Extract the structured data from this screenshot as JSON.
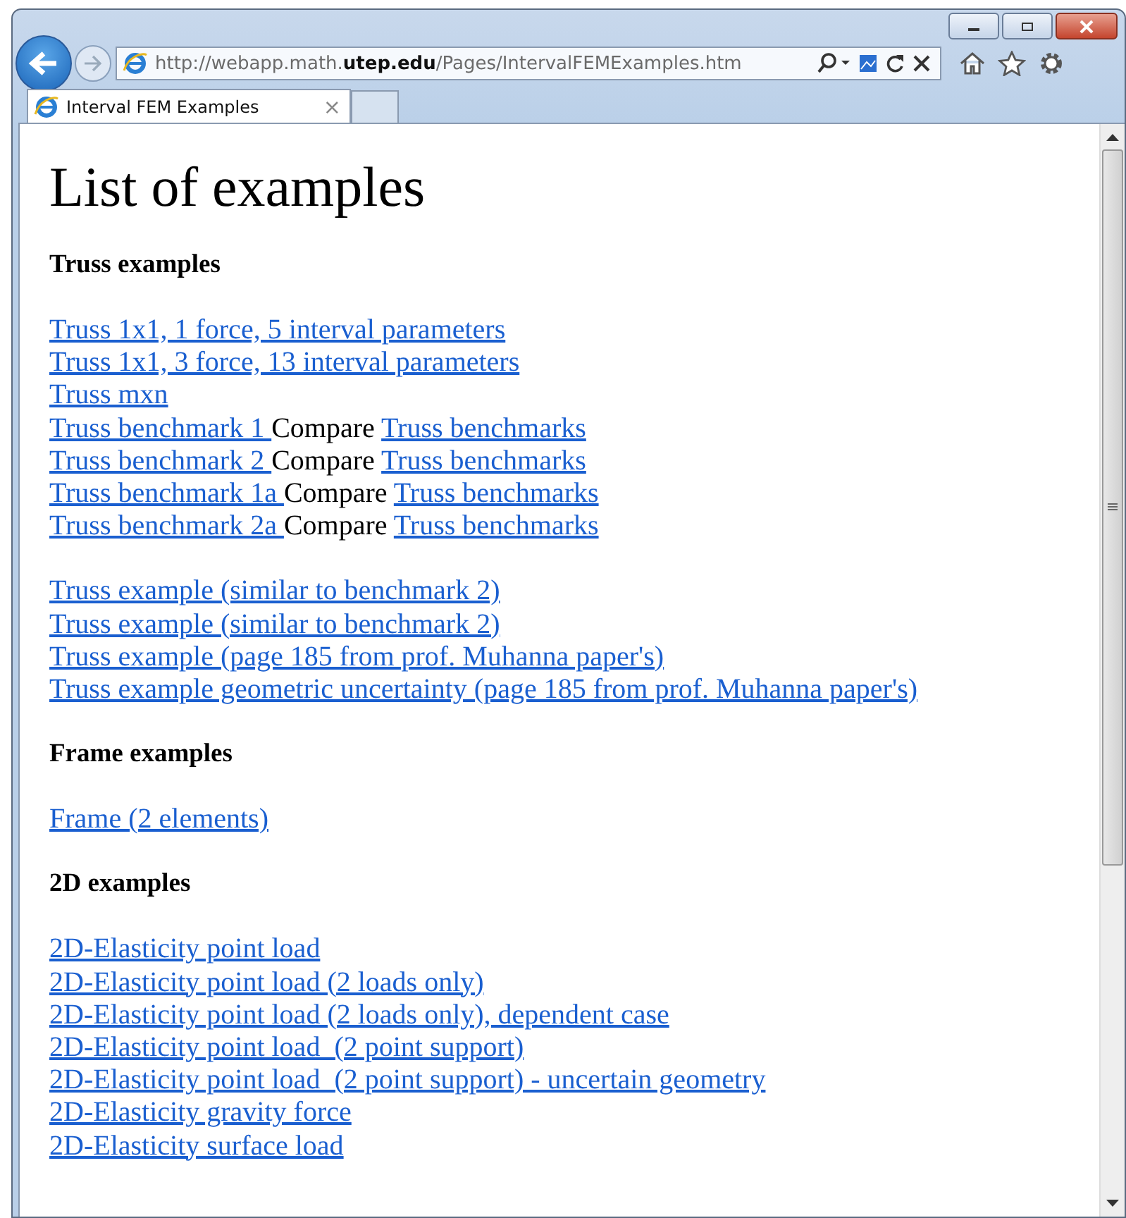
{
  "browser": {
    "url": "http://webapp.math.**utep.edu**/Pages/IntervalFEMExamples.htm",
    "tabs": [
      {
        "label": "Interval FEM Examples",
        "close": "×",
        "selected": true
      }
    ]
  },
  "page": {
    "title": "List of examples",
    "sections": [
      {
        "heading": "Truss examples",
        "groups": [
          [
            [
              {
                "kind": "link",
                "text": "Truss 1x1, 1 force, 5 interval parameters"
              }
            ],
            [
              {
                "kind": "link",
                "text": "Truss 1x1, 3 force, 13 interval parameters"
              }
            ],
            [
              {
                "kind": "link",
                "text": "Truss mxn"
              }
            ],
            [
              {
                "kind": "link",
                "text": "Truss benchmark 1 "
              },
              {
                "kind": "text",
                "text": "Compare"
              },
              {
                "kind": "link",
                "text": "Truss benchmarks"
              }
            ],
            [
              {
                "kind": "link",
                "text": "Truss benchmark 2 "
              },
              {
                "kind": "text",
                "text": "Compare"
              },
              {
                "kind": "link",
                "text": "Truss benchmarks"
              }
            ],
            [
              {
                "kind": "link",
                "text": "Truss benchmark 1a "
              },
              {
                "kind": "text",
                "text": "Compare"
              },
              {
                "kind": "link",
                "text": "Truss benchmarks"
              }
            ],
            [
              {
                "kind": "link",
                "text": "Truss benchmark 2a "
              },
              {
                "kind": "text",
                "text": "Compare"
              },
              {
                "kind": "link",
                "text": "Truss benchmarks"
              }
            ]
          ],
          [
            [
              {
                "kind": "link",
                "text": "Truss example (similar to benchmark 2)"
              }
            ],
            [
              {
                "kind": "link",
                "text": "Truss example (similar to benchmark 2)"
              }
            ],
            [
              {
                "kind": "link",
                "text": "Truss example (page 185 from prof. Muhanna paper's)"
              }
            ],
            [
              {
                "kind": "link",
                "text": "Truss example geometric uncertainty (page 185 from prof. Muhanna paper's)"
              }
            ]
          ]
        ]
      },
      {
        "heading": "Frame examples",
        "groups": [
          [
            [
              {
                "kind": "link",
                "text": "Frame (2 elements)"
              }
            ]
          ]
        ]
      },
      {
        "heading": "2D examples",
        "groups": [
          [
            [
              {
                "kind": "link",
                "text": "2D-Elasticity point load"
              }
            ],
            [
              {
                "kind": "link",
                "text": "2D-Elasticity point load (2 loads only)"
              }
            ],
            [
              {
                "kind": "link",
                "text": "2D-Elasticity point load (2 loads only), dependent case"
              }
            ],
            [
              {
                "kind": "link",
                "text": "2D-Elasticity point load  (2 point support)"
              }
            ],
            [
              {
                "kind": "link",
                "text": "2D-Elasticity point load  (2 point support) - uncertain geometry"
              }
            ],
            [
              {
                "kind": "link",
                "text": "2D-Elasticity gravity force"
              }
            ],
            [
              {
                "kind": "link",
                "text": "2D-Elasticity surface load"
              }
            ]
          ]
        ]
      }
    ]
  }
}
